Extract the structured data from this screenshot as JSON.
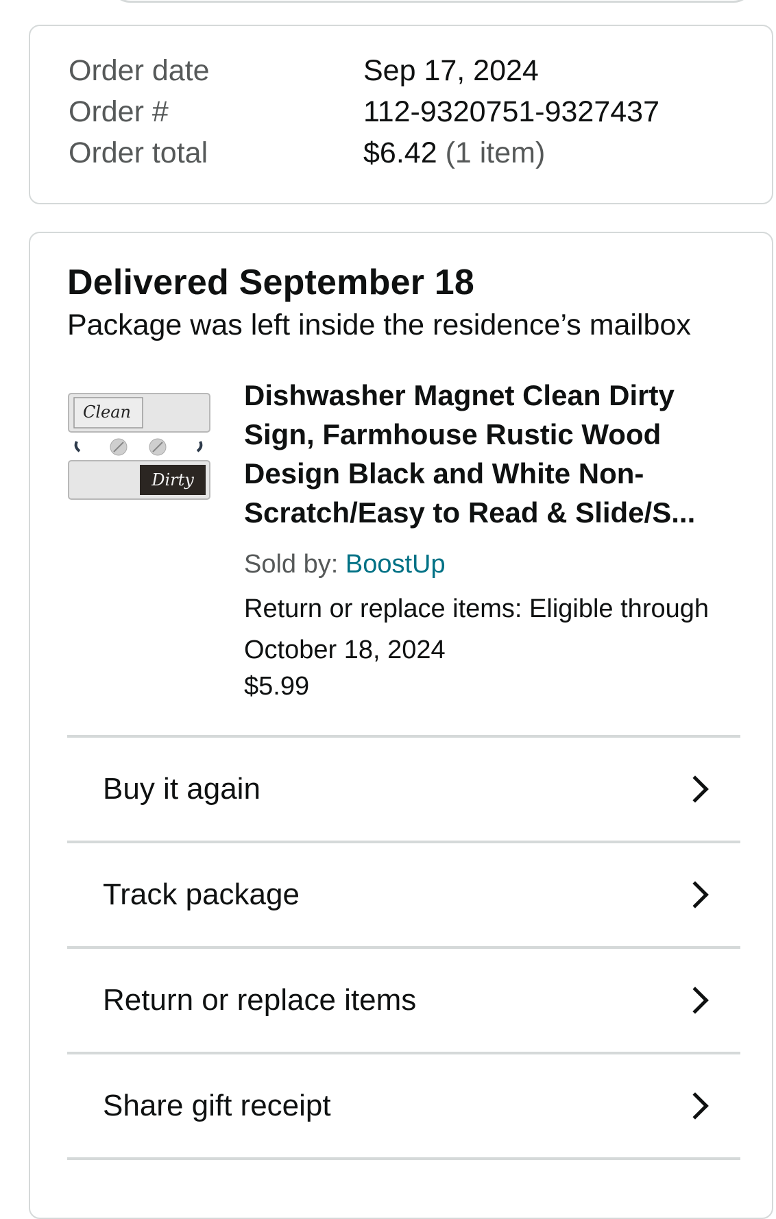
{
  "order_summary": {
    "date_label": "Order date",
    "date_value": "Sep 17, 2024",
    "number_label": "Order #",
    "number_value": "112-9320751-9327437",
    "total_label": "Order total",
    "total_value": "$6.42",
    "total_items": "(1 item)"
  },
  "shipment": {
    "status": "Delivered September 18",
    "detail": "Package was left inside the residence’s mailbox",
    "product": {
      "image_icon": "product-thumbnail-clean-dirty-magnet",
      "image_text_top": "Clean",
      "image_text_bottom": "Dirty",
      "title": "Dishwasher Magnet Clean Dirty Sign, Farmhouse Rustic Wood Design Black and White Non-Scratch/Easy to Read & Slide/S...",
      "sold_by_label": "Sold by: ",
      "seller": "BoostUp",
      "return_info": "Return or replace items: Eligible through October 18, 2024",
      "price": "$5.99"
    }
  },
  "actions": [
    {
      "label": "Buy it again",
      "icon": "chevron-right-icon"
    },
    {
      "label": "Track package",
      "icon": "chevron-right-icon"
    },
    {
      "label": "Return or replace items",
      "icon": "chevron-right-icon"
    },
    {
      "label": "Share gift receipt",
      "icon": "chevron-right-icon"
    }
  ],
  "colors": {
    "link": "#007185",
    "border": "#d5d9d9",
    "muted_text": "#565959",
    "text": "#0f1111"
  }
}
